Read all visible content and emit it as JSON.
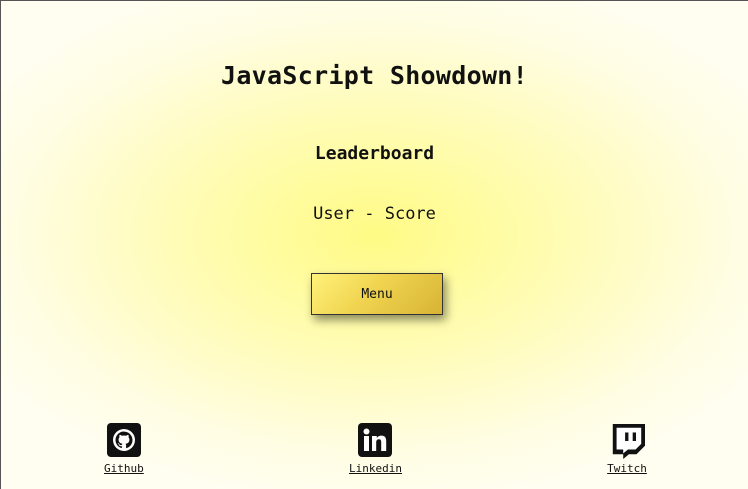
{
  "page": {
    "title": "JavaScript Showdown!",
    "subtitle": "Leaderboard",
    "leaderboard_header": "User - Score"
  },
  "menu_button": {
    "label": "Menu"
  },
  "footer": {
    "links": [
      {
        "label": "Github",
        "icon": "github-icon"
      },
      {
        "label": "Linkedin",
        "icon": "linkedin-icon"
      },
      {
        "label": "Twitch",
        "icon": "twitch-icon"
      }
    ]
  },
  "colors": {
    "background_center": "#fffb85",
    "background_edge": "#fffef0",
    "button_gradient_start": "#fff27a",
    "button_gradient_end": "#d8b335",
    "text": "#111111"
  }
}
